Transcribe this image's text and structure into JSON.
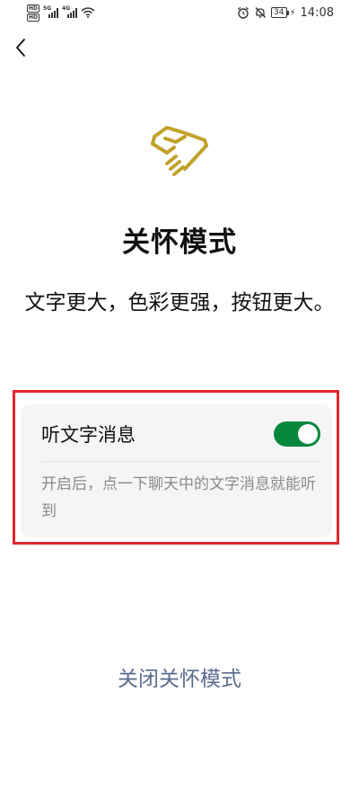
{
  "status_bar": {
    "hd_1": "HD",
    "hd_2": "HD",
    "network_1": "5G",
    "network_2": "4G",
    "battery": "34",
    "time": "14:08"
  },
  "page": {
    "title": "关怀模式",
    "subtitle": "文字更大，色彩更强，按钮更大。"
  },
  "listen_setting": {
    "label": "听文字消息",
    "enabled": true,
    "description": "开启后，点一下聊天中的文字消息就能听到"
  },
  "actions": {
    "close_mode": "关闭关怀模式"
  },
  "colors": {
    "accent_gold": "#c1a12b",
    "toggle_on": "#07883d",
    "highlight_border": "#e5262d",
    "link": "#5b6c8f"
  },
  "icons": [
    "back-arrow-icon",
    "care-mode-icon",
    "wifi-icon",
    "alarm-icon",
    "mute-bell-icon",
    "battery-icon"
  ]
}
